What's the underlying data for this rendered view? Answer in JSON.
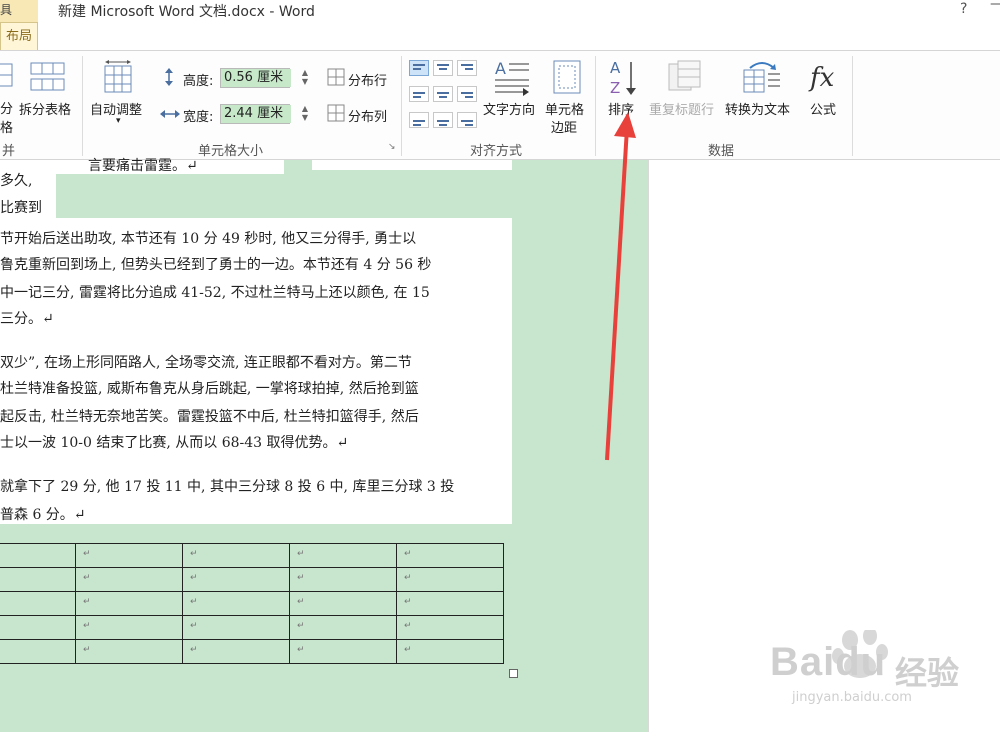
{
  "titlebar": {
    "tool_tab_fragment": "具",
    "title": "新建 Microsoft Word 文档.docx - Word",
    "help": "?",
    "minimize": "—"
  },
  "tabs": {
    "active_fragment": "布局"
  },
  "ribbon": {
    "merge_group": {
      "split_cells_fragment_1": "分",
      "split_cells_fragment_2": "格",
      "split_table": "拆分表格",
      "group_label_fragment": "并"
    },
    "cell_size_group": {
      "autofit": "自动调整",
      "height_label": "高度:",
      "height_value": "0.56 厘米",
      "width_label": "宽度:",
      "width_value": "2.44 厘米",
      "distribute_rows": "分布行",
      "distribute_cols": "分布列",
      "group_label": "单元格大小"
    },
    "alignment_group": {
      "text_direction": "文字方向",
      "cell_margins_line1": "单元格",
      "cell_margins_line2": "边距",
      "group_label": "对齐方式"
    },
    "data_group": {
      "sort": "排序",
      "repeat_header": "重复标题行",
      "convert_to_text": "转换为文本",
      "formula": "公式",
      "group_label": "数据"
    }
  },
  "document": {
    "top_fragment": "言要痛击雷霆。↵",
    "left_lines": [
      "多久,",
      "比赛到"
    ],
    "para1": [
      "节开始后送出助攻, 本节还有 10 分 49 秒时, 他又三分得手, 勇士以",
      "鲁克重新回到场上, 但势头已经到了勇士的一边。本节还有 4 分 56 秒",
      "中一记三分, 雷霆将比分追成 41-52, 不过杜兰特马上还以颜色, 在 15",
      "三分。↵"
    ],
    "para2": [
      "双少”, 在场上形同陌路人, 全场零交流, 连正眼都不看对方。第二节",
      "杜兰特准备投篮, 威斯布鲁克从身后跳起, 一掌将球拍掉, 然后抢到篮",
      "起反击, 杜兰特无奈地苦笑。雷霆投篮不中后, 杜兰特扣篮得手, 然后",
      "士以一波 10-0 结束了比赛, 从而以 68-43 取得优势。↵"
    ],
    "para3": [
      "就拿下了 29 分, 他 17 投 11 中, 其中三分球 8 投 6 中, 库里三分球 3 投",
      "普森 6 分。↵"
    ],
    "cell_mark": "↵",
    "table_rows": 5
  },
  "watermark": {
    "brand": "Bai",
    "brand2": "du",
    "cn": "经验",
    "url": "jingyan.baidu.com"
  },
  "colors": {
    "doc_bg": "#c8e6ce",
    "arrow": "#e8413c",
    "field_bg": "#c7e9c9"
  }
}
